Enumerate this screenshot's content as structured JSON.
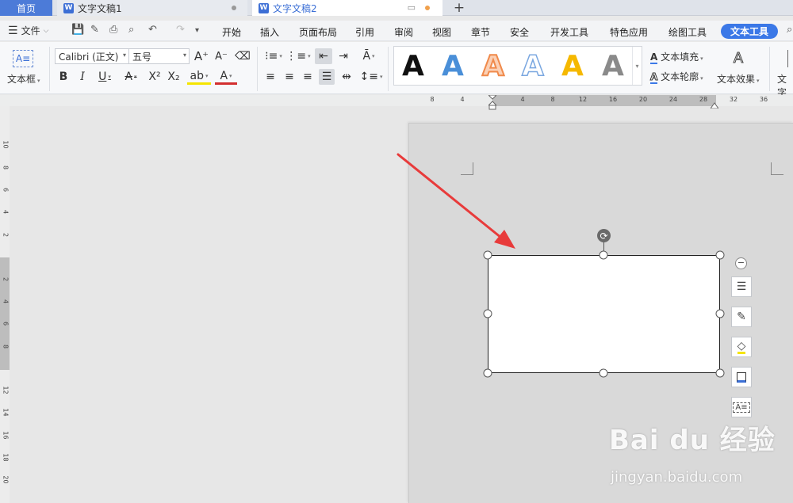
{
  "tabs": {
    "home": "首页",
    "doc1": "文字文稿1",
    "doc2": "文字文稿2",
    "plus": "+"
  },
  "menubar": {
    "file": "文件",
    "items": [
      "开始",
      "插入",
      "页面布局",
      "引用",
      "审阅",
      "视图",
      "章节",
      "安全",
      "开发工具",
      "特色应用",
      "绘图工具"
    ],
    "active": "文本工具"
  },
  "ribbon": {
    "textbox_label": "文本框",
    "font_name": "Calibri (正文)",
    "font_size": "五号",
    "gallery_letter": "A",
    "text_fill": "文本填充",
    "text_outline": "文本轮廓",
    "text_effect": "文本效果",
    "right_cut_label": "文字",
    "gallery_colors": [
      "#111111",
      "#4a8fd8",
      "#f08a4b",
      "#7aa7e0",
      "#f5b800",
      "#888888"
    ]
  },
  "hruler_ticks": [
    "8",
    "4",
    "4",
    "8",
    "12",
    "16",
    "20",
    "24",
    "28",
    "32",
    "36"
  ],
  "vruler_ticks": [
    "10",
    "8",
    "6",
    "4",
    "2",
    "2",
    "4",
    "6",
    "8",
    "12",
    "14",
    "16",
    "18",
    "20"
  ],
  "watermark": {
    "logo": "Bai du 经验",
    "sub": "jingyan.baidu.com"
  },
  "colors": {
    "accent": "#3b78e7",
    "annotation_arrow": "#e83b3b"
  }
}
